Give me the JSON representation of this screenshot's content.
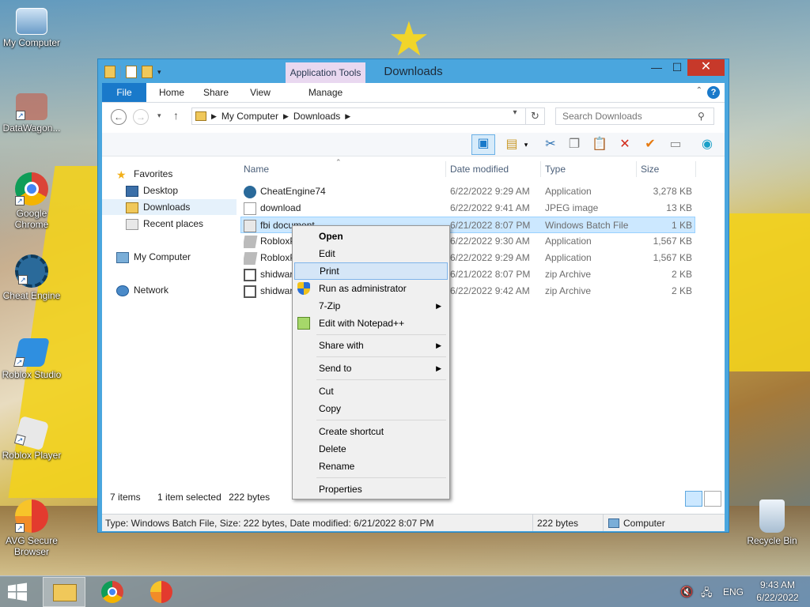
{
  "desktop": {
    "icons": [
      {
        "label": "My Computer"
      },
      {
        "label": "DataWagon..."
      },
      {
        "label": "Google Chrome"
      },
      {
        "label": "Cheat Engine"
      },
      {
        "label": "Roblox Studio"
      },
      {
        "label": "Roblox Player"
      },
      {
        "label": "AVG Secure Browser"
      },
      {
        "label": "Recycle Bin"
      }
    ]
  },
  "window": {
    "title": "Downloads",
    "context_tab": "Application Tools",
    "tabs": [
      "File",
      "Home",
      "Share",
      "View",
      "Manage"
    ],
    "close_glyph": "✕",
    "max_glyph": "☐",
    "min_glyph": "—",
    "help_glyph": "?",
    "address": {
      "segments": [
        "My Computer",
        "Downloads"
      ]
    },
    "search_placeholder": "Search Downloads"
  },
  "nav_pane": {
    "items": [
      {
        "label": "Favorites",
        "icon": "star-icon"
      },
      {
        "label": "Desktop",
        "icon": "desktop-icon"
      },
      {
        "label": "Downloads",
        "icon": "downloads-folder-icon"
      },
      {
        "label": "Recent places",
        "icon": "recent-places-icon"
      },
      {
        "label": "My Computer",
        "icon": "computer-icon"
      },
      {
        "label": "Network",
        "icon": "network-icon"
      }
    ]
  },
  "columns": {
    "name": "Name",
    "date": "Date modified",
    "type": "Type",
    "size": "Size"
  },
  "files": [
    {
      "name": "CheatEngine74",
      "date": "6/22/2022 9:29 AM",
      "type": "Application",
      "size": "3,278 KB"
    },
    {
      "name": "download",
      "date": "6/22/2022 9:41 AM",
      "type": "JPEG image",
      "size": "13 KB"
    },
    {
      "name": "fbi document",
      "date": "6/21/2022 8:07 PM",
      "type": "Windows Batch File",
      "size": "1 KB"
    },
    {
      "name": "RobloxP",
      "date": "6/22/2022 9:30 AM",
      "type": "Application",
      "size": "1,567 KB"
    },
    {
      "name": "RobloxP",
      "date": "6/22/2022 9:29 AM",
      "type": "Application",
      "size": "1,567 KB"
    },
    {
      "name": "shidwar",
      "date": "6/21/2022 8:07 PM",
      "type": "zip Archive",
      "size": "2 KB"
    },
    {
      "name": "shidwar",
      "date": "6/22/2022 9:42 AM",
      "type": "zip Archive",
      "size": "2 KB"
    }
  ],
  "status": {
    "items_count": "7 items",
    "selected": "1 item selected",
    "selected_size": "222 bytes",
    "bar_info": "Type: Windows Batch File, Size: 222 bytes, Date modified: 6/21/2022 8:07 PM",
    "bar_size": "222 bytes",
    "bar_location": "Computer"
  },
  "context_menu": {
    "items": [
      "Open",
      "Edit",
      "Print",
      "Run as administrator",
      "7-Zip",
      "Edit with Notepad++",
      "Share with",
      "Send to",
      "Cut",
      "Copy",
      "Create shortcut",
      "Delete",
      "Rename",
      "Properties"
    ],
    "highlighted": "Print"
  },
  "taskbar": {
    "language": "ENG",
    "time": "9:43 AM",
    "date": "6/22/2022"
  },
  "colors": {
    "accent": "#1979ca",
    "selection": "#cce8ff",
    "title_bar": "#4aa6de"
  }
}
